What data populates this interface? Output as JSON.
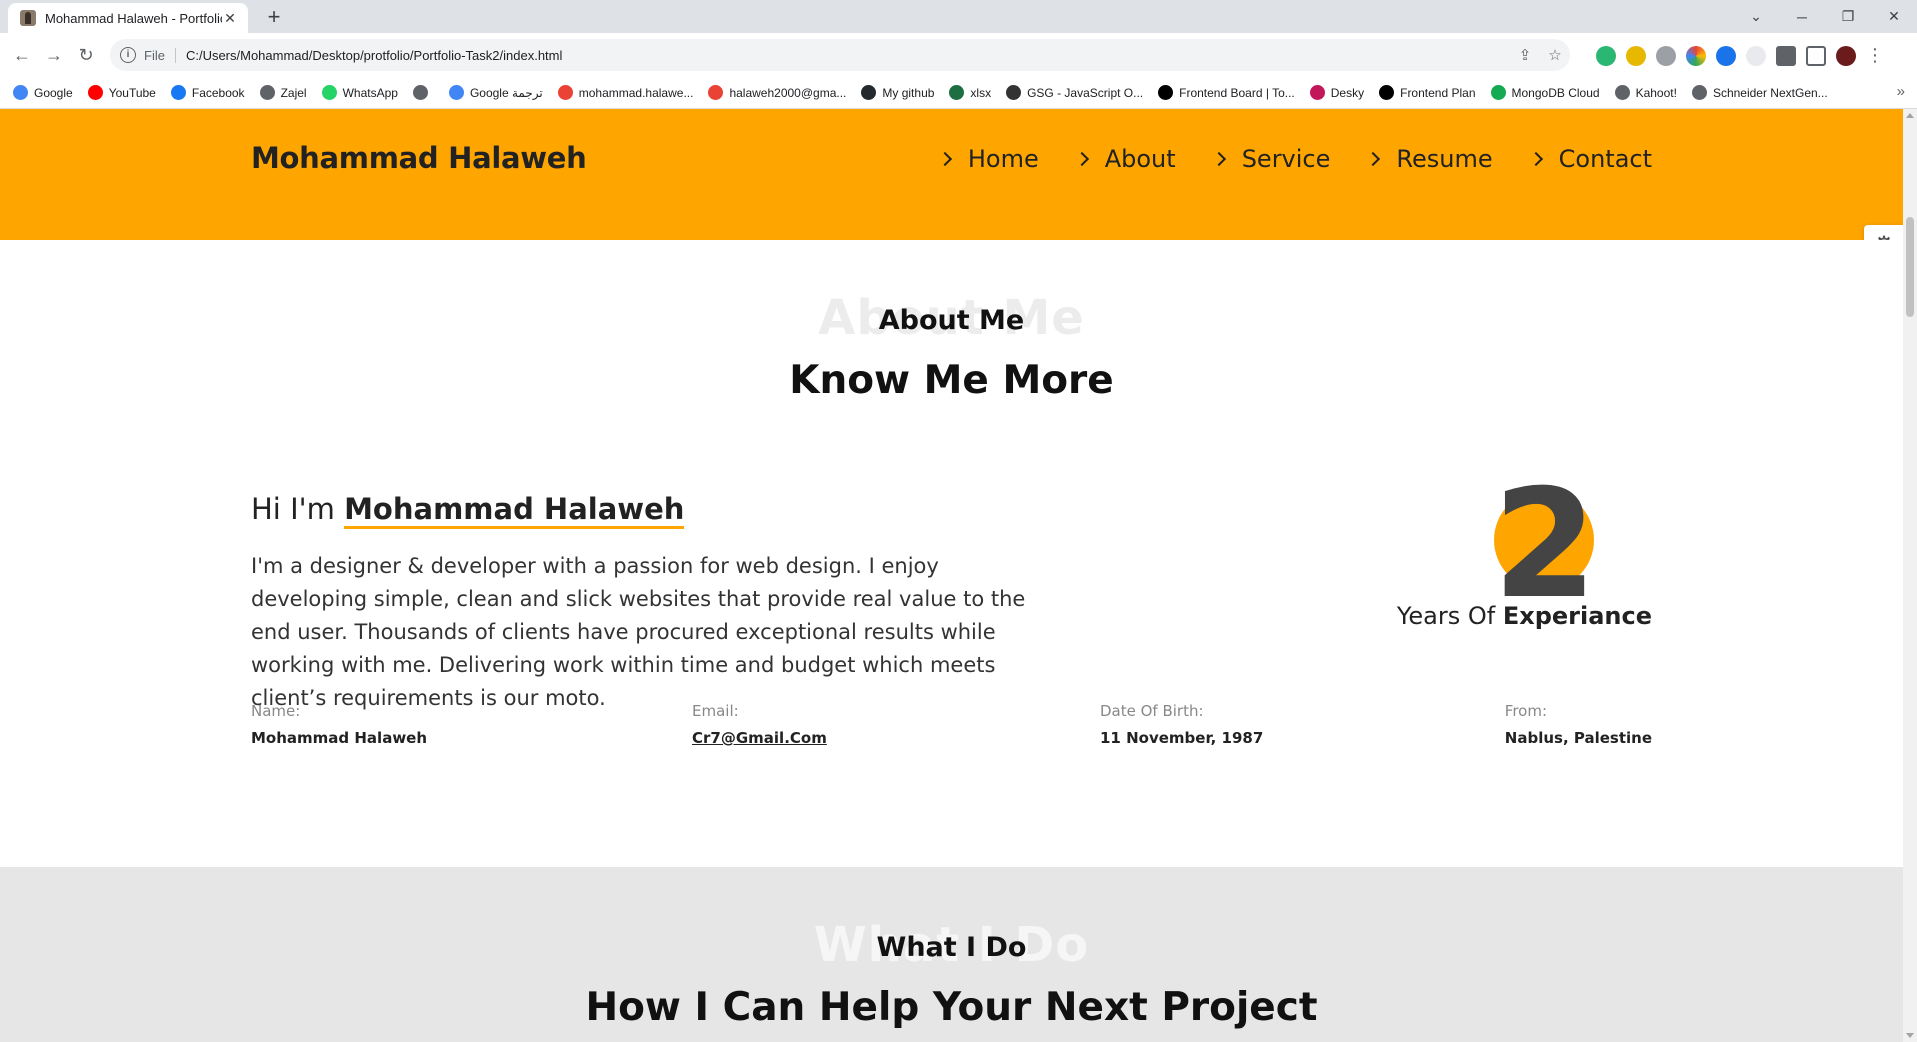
{
  "browser": {
    "tab_title": "Mohammad Halaweh - Portfolio",
    "tab_close": "✕",
    "new_tab": "+",
    "address_scheme": "File",
    "address_url": "C:/Users/Mohammad/Desktop/protfolio/Portfolio-Task2/index.html",
    "bookmarks": [
      {
        "label": "Google",
        "color": "#4285f4"
      },
      {
        "label": "YouTube",
        "color": "#ff0000"
      },
      {
        "label": "Facebook",
        "color": "#1877f2"
      },
      {
        "label": "Zajel",
        "color": "#5f6368"
      },
      {
        "label": "WhatsApp",
        "color": "#25d366"
      },
      {
        "label": "",
        "color": "#5f6368"
      },
      {
        "label": "Google ترجمة",
        "color": "#4285f4"
      },
      {
        "label": "mohammad.halawe...",
        "color": "#ea4335"
      },
      {
        "label": "halaweh2000@gma...",
        "color": "#ea4335"
      },
      {
        "label": "My github",
        "color": "#24292e"
      },
      {
        "label": "xlsx",
        "color": "#1d6f42"
      },
      {
        "label": "GSG - JavaScript O...",
        "color": "#333333"
      },
      {
        "label": "Frontend Board | To...",
        "color": "#000000"
      },
      {
        "label": "Desky",
        "color": "#c2185b"
      },
      {
        "label": "Frontend Plan",
        "color": "#000000"
      },
      {
        "label": "MongoDB Cloud",
        "color": "#13aa52"
      },
      {
        "label": "Kahoot!",
        "color": "#5f6368"
      },
      {
        "label": "Schneider NextGen...",
        "color": "#5f6368"
      }
    ],
    "bookmarks_more": "»"
  },
  "site": {
    "brand": "Mohammad Halaweh",
    "accent": "#ffa500",
    "nav": [
      {
        "label": "Home"
      },
      {
        "label": "About"
      },
      {
        "label": "Service"
      },
      {
        "label": "Resume"
      },
      {
        "label": "Contact"
      }
    ]
  },
  "about": {
    "ghost": "About Me",
    "label": "About Me",
    "title": "Know Me More",
    "hi_prefix": "Hi I'm ",
    "name": "Mohammad Halaweh",
    "bio": "I'm a designer & developer with a passion for web design. I enjoy developing simple, clean and slick websites that provide real value to the end user. Thousands of clients have procured exceptional results while working with me. Delivering work within time and budget which meets client’s requirements is our moto.",
    "years_number": "2",
    "years_prefix": "Years Of ",
    "years_bold": "Experiance",
    "info": [
      {
        "label": "Name:",
        "value": "Mohammad Halaweh"
      },
      {
        "label": "Email:",
        "value": "Cr7@Gmail.Com"
      },
      {
        "label": "Date Of Birth:",
        "value": "11 November, 1987"
      },
      {
        "label": "From:",
        "value": "Nablus, Palestine"
      }
    ]
  },
  "whatido": {
    "ghost": "What I Do",
    "label": "What I Do",
    "title": "How I Can Help Your Next Project"
  }
}
